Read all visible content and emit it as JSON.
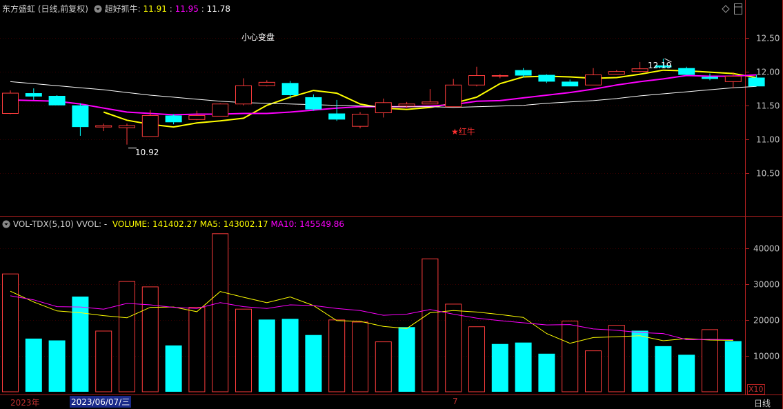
{
  "price_header": {
    "stock_name": "东方盛虹 (日线,前复权)",
    "indicator_name": "超好抓牛",
    "separator": ":",
    "v1": "11.91",
    "v2": "11.95",
    "v3": "11.78",
    "colon_sep": " : "
  },
  "vol_header": {
    "indicator": "VOL-TDX(5,10)",
    "vvol": "VVOL: -",
    "volume": "VOLUME: 141402.27",
    "ma5": "MA5: 143002.17",
    "ma10": "MA10: 145549.86"
  },
  "annotations": {
    "xiaoxin": "小心变盘",
    "hongniu": "★红牛",
    "high_label": "12.19",
    "low_label": "10.92"
  },
  "x_axis": {
    "left_label": "2023年",
    "selected_date": "2023/06/07/三",
    "month_label": "7",
    "period": "日线",
    "scale_label": "X10"
  },
  "colors": {
    "up": "#ff3c3c",
    "down": "#00ffff",
    "ma_yellow": "#ffff00",
    "ma_magenta": "#ff00ff",
    "ma_white": "#ffffff",
    "axis": "#b02020",
    "label": "#c0c0c0"
  },
  "chart_data": [
    {
      "type": "candlestick",
      "title": "东方盛虹 (日线,前复权)",
      "y_ticks": [
        "12.50",
        "12.00",
        "11.50",
        "11.00",
        "10.50"
      ],
      "ylim": [
        10.0,
        12.75
      ],
      "candles": [
        {
          "o": 11.38,
          "h": 11.72,
          "l": 11.37,
          "c": 11.68
        },
        {
          "o": 11.68,
          "h": 11.75,
          "l": 11.58,
          "c": 11.63
        },
        {
          "o": 11.64,
          "h": 11.65,
          "l": 11.5,
          "c": 11.5
        },
        {
          "o": 11.5,
          "h": 11.53,
          "l": 11.05,
          "c": 11.18
        },
        {
          "o": 11.18,
          "h": 11.23,
          "l": 11.12,
          "c": 11.2
        },
        {
          "o": 11.17,
          "h": 11.23,
          "l": 10.92,
          "c": 11.2
        },
        {
          "o": 11.04,
          "h": 11.43,
          "l": 11.04,
          "c": 11.35
        },
        {
          "o": 11.35,
          "h": 11.37,
          "l": 11.22,
          "c": 11.25
        },
        {
          "o": 11.29,
          "h": 11.42,
          "l": 11.28,
          "c": 11.35
        },
        {
          "o": 11.34,
          "h": 11.53,
          "l": 11.34,
          "c": 11.52
        },
        {
          "o": 11.52,
          "h": 11.9,
          "l": 11.5,
          "c": 11.79
        },
        {
          "o": 11.79,
          "h": 11.87,
          "l": 11.78,
          "c": 11.84
        },
        {
          "o": 11.83,
          "h": 11.86,
          "l": 11.6,
          "c": 11.65
        },
        {
          "o": 11.62,
          "h": 11.66,
          "l": 11.42,
          "c": 11.44
        },
        {
          "o": 11.38,
          "h": 11.58,
          "l": 11.27,
          "c": 11.29
        },
        {
          "o": 11.19,
          "h": 11.4,
          "l": 11.16,
          "c": 11.37
        },
        {
          "o": 11.39,
          "h": 11.6,
          "l": 11.32,
          "c": 11.54
        },
        {
          "o": 11.49,
          "h": 11.55,
          "l": 11.46,
          "c": 11.52
        },
        {
          "o": 11.52,
          "h": 11.74,
          "l": 11.52,
          "c": 11.55
        },
        {
          "o": 11.48,
          "h": 11.89,
          "l": 11.48,
          "c": 11.8
        },
        {
          "o": 11.8,
          "h": 12.07,
          "l": 11.78,
          "c": 11.94
        },
        {
          "o": 11.93,
          "h": 11.96,
          "l": 11.9,
          "c": 11.94
        },
        {
          "o": 12.02,
          "h": 12.05,
          "l": 11.91,
          "c": 11.94
        },
        {
          "o": 11.95,
          "h": 11.96,
          "l": 11.83,
          "c": 11.85
        },
        {
          "o": 11.85,
          "h": 11.88,
          "l": 11.78,
          "c": 11.78
        },
        {
          "o": 11.8,
          "h": 12.05,
          "l": 11.8,
          "c": 11.95
        },
        {
          "o": 11.96,
          "h": 12.02,
          "l": 11.96,
          "c": 12.0
        },
        {
          "o": 12.0,
          "h": 12.14,
          "l": 11.99,
          "c": 12.04
        },
        {
          "o": 12.09,
          "h": 12.19,
          "l": 12.07,
          "c": 12.06
        },
        {
          "o": 12.05,
          "h": 12.07,
          "l": 11.95,
          "c": 11.95
        },
        {
          "o": 11.92,
          "h": 11.97,
          "l": 11.87,
          "c": 11.89
        },
        {
          "o": 11.85,
          "h": 11.99,
          "l": 11.75,
          "c": 11.93
        },
        {
          "o": 11.91,
          "h": 11.95,
          "l": 11.78,
          "c": 11.78
        }
      ],
      "series": [
        {
          "color": "#ffff00",
          "values": [
            null,
            null,
            null,
            null,
            11.4,
            11.28,
            11.22,
            11.18,
            11.24,
            11.27,
            11.31,
            11.5,
            11.62,
            11.72,
            11.68,
            11.52,
            11.46,
            11.44,
            11.47,
            11.53,
            11.62,
            11.82,
            11.92,
            11.93,
            11.92,
            11.9,
            11.91,
            11.96,
            12.02,
            12.01,
            11.99,
            11.97,
            11.91
          ]
        },
        {
          "color": "#ff00ff",
          "values": [
            11.58,
            11.57,
            11.56,
            11.52,
            11.46,
            11.4,
            11.38,
            11.36,
            11.37,
            11.37,
            11.38,
            11.38,
            11.4,
            11.43,
            11.46,
            11.48,
            11.48,
            11.48,
            11.49,
            11.51,
            11.56,
            11.57,
            11.61,
            11.65,
            11.69,
            11.74,
            11.8,
            11.85,
            11.89,
            11.94,
            11.93,
            11.93,
            11.95
          ]
        },
        {
          "color": "#ffffff",
          "values": [
            11.85,
            11.82,
            11.79,
            11.76,
            11.73,
            11.69,
            11.65,
            11.62,
            11.59,
            11.56,
            11.54,
            11.53,
            11.52,
            11.51,
            11.5,
            11.49,
            11.48,
            11.48,
            11.48,
            11.47,
            11.48,
            11.49,
            11.5,
            11.53,
            11.55,
            11.57,
            11.6,
            11.64,
            11.67,
            11.7,
            11.73,
            11.76,
            11.78
          ]
        }
      ]
    },
    {
      "type": "bar",
      "title": "VOL-TDX(5,10)",
      "y_ticks": [
        "40000",
        "30000",
        "20000",
        "10000"
      ],
      "ylim": [
        0,
        48000
      ],
      "values": [
        32800,
        14800,
        14300,
        26500,
        16900,
        30700,
        29200,
        12900,
        23500,
        44000,
        23000,
        20100,
        20300,
        15800,
        20000,
        19400,
        13900,
        18000,
        37000,
        24400,
        18100,
        13300,
        13700,
        10600,
        19700,
        11400,
        18500,
        17000,
        12700,
        10300,
        17300,
        14100
      ],
      "rising": [
        true,
        false,
        false,
        false,
        true,
        true,
        true,
        false,
        true,
        true,
        true,
        false,
        false,
        false,
        true,
        true,
        true,
        false,
        true,
        true,
        true,
        false,
        false,
        false,
        true,
        true,
        true,
        false,
        false,
        false,
        true,
        false
      ],
      "series": [
        {
          "color": "#ffff00",
          "values": [
            28000,
            25000,
            22500,
            22000,
            21200,
            20600,
            23500,
            23600,
            22300,
            27900,
            26300,
            24800,
            26400,
            24000,
            19800,
            19600,
            18200,
            17600,
            22000,
            22600,
            22200,
            21500,
            20700,
            16200,
            13500,
            15100,
            15300,
            15600,
            14200,
            14800,
            14400,
            14300
          ]
        },
        {
          "color": "#ff00ff",
          "values": [
            26700,
            25600,
            23700,
            23600,
            23000,
            24600,
            24200,
            23500,
            23200,
            24800,
            23700,
            23200,
            24200,
            24000,
            23200,
            22600,
            21300,
            21600,
            22900,
            21600,
            20500,
            19800,
            19200,
            18600,
            18700,
            17500,
            17100,
            16500,
            16200,
            14500,
            14600,
            14500
          ]
        }
      ]
    }
  ]
}
